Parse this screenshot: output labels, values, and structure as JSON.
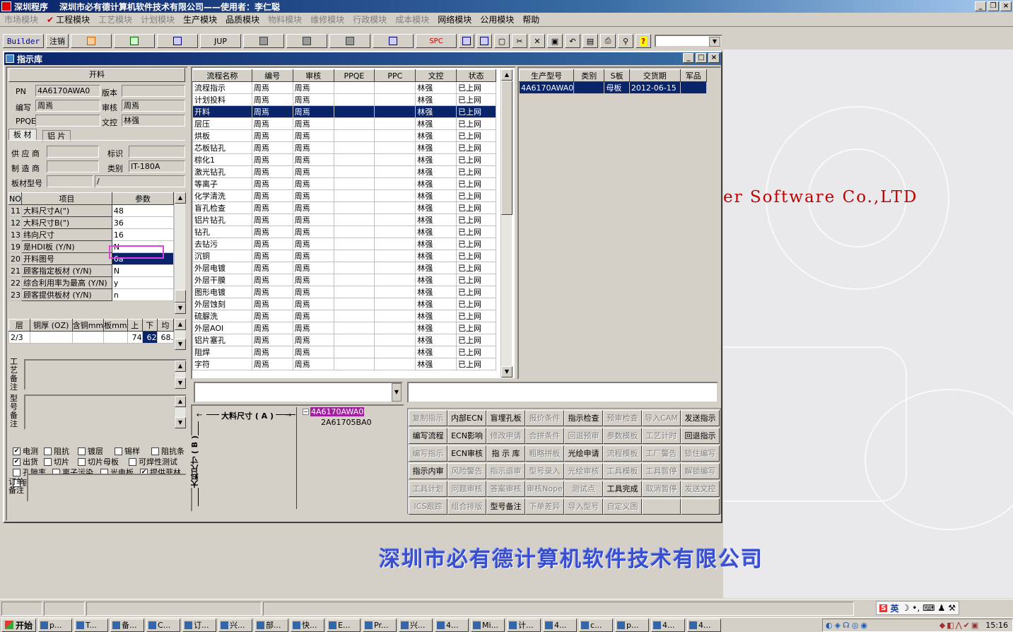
{
  "app": {
    "program_label": "深圳程序",
    "title": "深圳市必有德计算机软件技术有限公司——使用者：李仁聪"
  },
  "menu": [
    {
      "label": "市场模块",
      "enabled": false
    },
    {
      "label": "工程模块",
      "enabled": true,
      "checked": true
    },
    {
      "label": "工艺模块",
      "enabled": false
    },
    {
      "label": "计划模块",
      "enabled": false
    },
    {
      "label": "生产模块",
      "enabled": true
    },
    {
      "label": "品质模块",
      "enabled": true
    },
    {
      "label": "物料模块",
      "enabled": false
    },
    {
      "label": "维修模块",
      "enabled": false
    },
    {
      "label": "行政模块",
      "enabled": false
    },
    {
      "label": "成本模块",
      "enabled": false
    },
    {
      "label": "网络模块",
      "enabled": true
    },
    {
      "label": "公用模块",
      "enabled": true
    },
    {
      "label": "帮助",
      "enabled": true
    }
  ],
  "toolbar": {
    "builder": "Builder",
    "logout": "注销",
    "jup": "JUP",
    "spc": "SPC"
  },
  "bg_text": "er Software Co.,LTD",
  "bg_company": "深圳市必有德计算机软件技术有限公司",
  "window": {
    "title": "指示库"
  },
  "left": {
    "section_title": "开料",
    "pn_label": "PN",
    "pn_value": "4A6170AWA0",
    "version_label": "版本",
    "version_value": "",
    "author_label": "编写",
    "author_value": "周焉",
    "review_label": "审核",
    "review_value": "周焉",
    "ppqe_label": "PPQE",
    "ppqe_value": "",
    "doc_label": "文控",
    "doc_value": "林强",
    "tabs": [
      "板 材",
      "铝 片"
    ],
    "supplier_label": "供 应 商",
    "supplier_value": "",
    "mark_label": "标识",
    "mark_value": "",
    "maker_label": "制 造 商",
    "maker_value": "",
    "category_label": "类别",
    "category_value": "IT-180A",
    "model_label": "板材型号",
    "model_value": "",
    "model_value2": "/",
    "param_headers": [
      "NO",
      "项目",
      "参数"
    ],
    "params": [
      {
        "no": "11",
        "item": "大料尺寸A(\")",
        "value": "48"
      },
      {
        "no": "12",
        "item": "大料尺寸B(\")",
        "value": "36"
      },
      {
        "no": "13",
        "item": "纬向尺寸",
        "value": "16"
      },
      {
        "no": "19",
        "item": "是HDI板 (Y/N)",
        "value": "N"
      },
      {
        "no": "20",
        "item": "开料图号",
        "value": "6a"
      },
      {
        "no": "21",
        "item": "顾客指定板材 (Y/N)",
        "value": "N"
      },
      {
        "no": "22",
        "item": "综合利用率为最高 (Y/N)",
        "value": "y"
      },
      {
        "no": "23",
        "item": "顾客提供板材 (Y/N)",
        "value": "n"
      }
    ],
    "layer_headers": [
      "层",
      "铜厚 (OZ)",
      "含铜mm",
      "板mm",
      "上",
      "下",
      "均"
    ],
    "layer_row": [
      "2/3",
      "",
      "",
      "",
      "74",
      "62",
      "68."
    ],
    "process_note_label": "工艺备注",
    "model_note_label": "型号备注",
    "checks": [
      {
        "label": "电测",
        "checked": true
      },
      {
        "label": "阻抗",
        "checked": false
      },
      {
        "label": "镀层",
        "checked": false
      },
      {
        "label": "锡样",
        "checked": false
      },
      {
        "label": "阻抗条",
        "checked": false
      },
      {
        "label": "出货",
        "checked": true
      },
      {
        "label": "切片",
        "checked": false
      },
      {
        "label": "切片母板",
        "checked": false
      },
      {
        "label": "可焊性测试",
        "checked": false
      },
      {
        "label": "孔隙率",
        "checked": false
      },
      {
        "label": "离子污染",
        "checked": false
      },
      {
        "label": "光电板",
        "checked": false
      },
      {
        "label": "提供菲林",
        "checked": true
      },
      {
        "label": "顾客提供板材",
        "checked": false
      }
    ],
    "order_note_label": "订单备注"
  },
  "flow": {
    "headers": [
      "流程名称",
      "编号",
      "审核",
      "PPQE",
      "PPC",
      "文控",
      "状态"
    ],
    "rows": [
      [
        "流程指示",
        "周焉",
        "周焉",
        "",
        "",
        "林强",
        "已上网"
      ],
      [
        "计划投料",
        "周焉",
        "周焉",
        "",
        "",
        "林强",
        "已上网"
      ],
      [
        "开料",
        "周焉",
        "周焉",
        "",
        "",
        "林强",
        "已上网"
      ],
      [
        "层压",
        "周焉",
        "周焉",
        "",
        "",
        "林强",
        "已上网"
      ],
      [
        "烘板",
        "周焉",
        "周焉",
        "",
        "",
        "林强",
        "已上网"
      ],
      [
        "芯板钻孔",
        "周焉",
        "周焉",
        "",
        "",
        "林强",
        "已上网"
      ],
      [
        "棕化1",
        "周焉",
        "周焉",
        "",
        "",
        "林强",
        "已上网"
      ],
      [
        "激光钻孔",
        "周焉",
        "周焉",
        "",
        "",
        "林强",
        "已上网"
      ],
      [
        "等离子",
        "周焉",
        "周焉",
        "",
        "",
        "林强",
        "已上网"
      ],
      [
        "化学清洗",
        "周焉",
        "周焉",
        "",
        "",
        "林强",
        "已上网"
      ],
      [
        "盲孔检查",
        "周焉",
        "周焉",
        "",
        "",
        "林强",
        "已上网"
      ],
      [
        "铝片钻孔",
        "周焉",
        "周焉",
        "",
        "",
        "林强",
        "已上网"
      ],
      [
        "钻孔",
        "周焉",
        "周焉",
        "",
        "",
        "林强",
        "已上网"
      ],
      [
        "去钻污",
        "周焉",
        "周焉",
        "",
        "",
        "林强",
        "已上网"
      ],
      [
        "沉铜",
        "周焉",
        "周焉",
        "",
        "",
        "林强",
        "已上网"
      ],
      [
        "外层电镀",
        "周焉",
        "周焉",
        "",
        "",
        "林强",
        "已上网"
      ],
      [
        "外层干膜",
        "周焉",
        "周焉",
        "",
        "",
        "林强",
        "已上网"
      ],
      [
        "图形电镀",
        "周焉",
        "周焉",
        "",
        "",
        "林强",
        "已上网"
      ],
      [
        "外层蚀刻",
        "周焉",
        "周焉",
        "",
        "",
        "林强",
        "已上网"
      ],
      [
        "硫脲洗",
        "周焉",
        "周焉",
        "",
        "",
        "林强",
        "已上网"
      ],
      [
        "外层AOI",
        "周焉",
        "周焉",
        "",
        "",
        "林强",
        "已上网"
      ],
      [
        "铝片塞孔",
        "周焉",
        "周焉",
        "",
        "",
        "林强",
        "已上网"
      ],
      [
        "阻焊",
        "周焉",
        "周焉",
        "",
        "",
        "林强",
        "已上网"
      ],
      [
        "字符",
        "周焉",
        "周焉",
        "",
        "",
        "林强",
        "已上网"
      ]
    ],
    "selected_index": 2
  },
  "models": {
    "headers": [
      "生产型号",
      "类别",
      "S板",
      "交货期",
      "军品"
    ],
    "rows": [
      [
        "4A6170AWA0",
        "",
        "母板",
        "2012-06-15",
        ""
      ]
    ]
  },
  "diagram": {
    "dim_a": "大料尺寸 ( A )",
    "dim_b": "大料尺寸 ( B )"
  },
  "tree": {
    "root": "4A6170AWA0",
    "child": "2A61705BA0"
  },
  "actions": [
    {
      "label": "复制指示",
      "enabled": false
    },
    {
      "label": "内部ECN",
      "enabled": true
    },
    {
      "label": "盲埋孔板",
      "enabled": true
    },
    {
      "label": "报价条件",
      "enabled": false
    },
    {
      "label": "指示检查",
      "enabled": true
    },
    {
      "label": "预审检查",
      "enabled": false
    },
    {
      "label": "导入CAM",
      "enabled": false
    },
    {
      "label": "发送指示",
      "enabled": true
    },
    {
      "label": "编写流程",
      "enabled": true
    },
    {
      "label": "ECN影响",
      "enabled": true
    },
    {
      "label": "修改申请",
      "enabled": false
    },
    {
      "label": "合拼条件",
      "enabled": false
    },
    {
      "label": "回退预审",
      "enabled": false
    },
    {
      "label": "参数模板",
      "enabled": false
    },
    {
      "label": "工艺计时",
      "enabled": false
    },
    {
      "label": "回退指示",
      "enabled": true
    },
    {
      "label": "编写指示",
      "enabled": false
    },
    {
      "label": "ECN审核",
      "enabled": true
    },
    {
      "label": "指 示 库",
      "enabled": true
    },
    {
      "label": "粗略拼板",
      "enabled": false
    },
    {
      "label": "光绘申请",
      "enabled": true
    },
    {
      "label": "流程模板",
      "enabled": false
    },
    {
      "label": "工厂警告",
      "enabled": false
    },
    {
      "label": "锁住编写",
      "enabled": false
    },
    {
      "label": "指示内审",
      "enabled": true
    },
    {
      "label": "风险警告",
      "enabled": false
    },
    {
      "label": "指示退审",
      "enabled": false
    },
    {
      "label": "型号录入",
      "enabled": false
    },
    {
      "label": "光绘审核",
      "enabled": false
    },
    {
      "label": "工具模板",
      "enabled": false
    },
    {
      "label": "工具暂停",
      "enabled": false
    },
    {
      "label": "解锁编写",
      "enabled": false
    },
    {
      "label": "工具计划",
      "enabled": false
    },
    {
      "label": "问题审核",
      "enabled": false
    },
    {
      "label": "答案审核",
      "enabled": false
    },
    {
      "label": "审核Nope",
      "enabled": false
    },
    {
      "label": "测试点",
      "enabled": false
    },
    {
      "label": "工具完成",
      "enabled": true
    },
    {
      "label": "取消暂停",
      "enabled": false
    },
    {
      "label": "发送文控",
      "enabled": false
    },
    {
      "label": "ICS跟踪",
      "enabled": false
    },
    {
      "label": "组合排版",
      "enabled": false
    },
    {
      "label": "型号备注",
      "enabled": true
    },
    {
      "label": "下单差异",
      "enabled": false
    },
    {
      "label": "导入型号",
      "enabled": false
    },
    {
      "label": "自定义图",
      "enabled": false
    },
    {
      "label": "",
      "enabled": false
    },
    {
      "label": "",
      "enabled": false
    }
  ],
  "ime": {
    "lang": "英"
  },
  "taskbar": {
    "start": "开始",
    "tasks": [
      "p...",
      "T...",
      "备...",
      "C...",
      "订...",
      "兴...",
      "部...",
      "快...",
      "E...",
      "Pr...",
      "兴...",
      "4...",
      "Mi...",
      "计...",
      "4...",
      "c...",
      "p...",
      "4...",
      "4..."
    ],
    "clock": "15:16"
  }
}
